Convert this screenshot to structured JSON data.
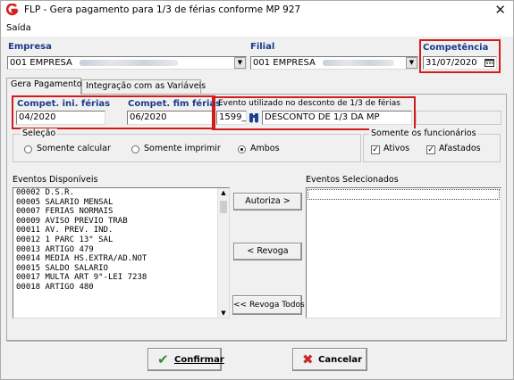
{
  "window": {
    "title": "FLP - Gera pagamento para 1/3 de férias conforme MP 927",
    "close_glyph": "✕",
    "logo_icon": "flp-logo-icon"
  },
  "menu": {
    "items": [
      "Saída"
    ]
  },
  "header": {
    "empresa_label": "Empresa",
    "empresa_value": "001 EMPRESA",
    "filial_label": "Filial",
    "filial_value": "001 EMPRESA",
    "competencia_label": "Competência",
    "competencia_value": "31/07/2020"
  },
  "tabs": [
    {
      "label": "Gera Pagamento",
      "active": true
    },
    {
      "label": "Integração com as Variáveis",
      "active": false
    }
  ],
  "periodo": {
    "ini_label": "Compet. ini. férias",
    "ini_value": "04/2020",
    "fim_label": "Compet. fim férias",
    "fim_value": "06/2020"
  },
  "evento": {
    "label": "Evento utilizado no desconto de 1/3 de férias",
    "code": "1599_",
    "description": "DESCONTO DE 1/3 DA MP"
  },
  "selecao": {
    "title": "Seleção",
    "options": [
      "Somente calcular",
      "Somente imprimir",
      "Ambos"
    ],
    "selected": "Ambos"
  },
  "funcionarios": {
    "title": "Somente os funcionários",
    "ativos_label": "Ativos",
    "ativos_checked": true,
    "afastados_label": "Afastados",
    "afastados_checked": true
  },
  "eventos_disponiveis": {
    "label": "Eventos Disponíveis",
    "items": [
      "00002 D.S.R.",
      "00005 SALARIO MENSAL",
      "00007 FERIAS NORMAIS",
      "00009 AVISO PREVIO TRAB",
      "00011 AV. PREV. IND.",
      "00012 1 PARC 13° SAL",
      "00013 ARTIGO 479",
      "00014 MEDIA HS.EXTRA/AD.NOT",
      "00015 SALDO SALARIO",
      "00017 MULTA ART 9°-LEI 7238",
      "00018 ARTIGO 480"
    ]
  },
  "eventos_selecionados": {
    "label": "Eventos Selecionados",
    "items": []
  },
  "buttons": {
    "autoriza": "Autoriza >",
    "revoga": "< Revoga",
    "revoga_todos": "<< Revoga Todos",
    "confirmar": "Confirmar",
    "cancelar": "Cancelar"
  },
  "colors": {
    "highlight": "#d21c1c",
    "label_blue": "#1a3a8c",
    "confirm_green": "#2e8b2e",
    "cancel_red": "#c62828"
  }
}
